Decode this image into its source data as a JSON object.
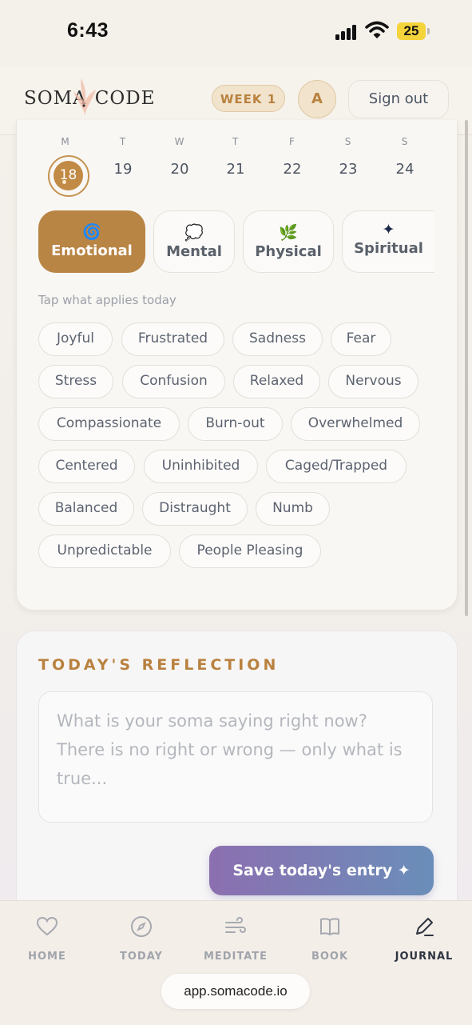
{
  "status_bar": {
    "time": "6:43",
    "battery": "25"
  },
  "header": {
    "logo_left": "SOMA",
    "logo_right": "CODE",
    "week": "WEEK 1",
    "avatar_initial": "A",
    "sign_out": "Sign out"
  },
  "days": [
    {
      "letter": "M",
      "num": "18",
      "selected": true
    },
    {
      "letter": "T",
      "num": "19"
    },
    {
      "letter": "W",
      "num": "20"
    },
    {
      "letter": "T",
      "num": "21"
    },
    {
      "letter": "F",
      "num": "22"
    },
    {
      "letter": "S",
      "num": "23"
    },
    {
      "letter": "S",
      "num": "24"
    }
  ],
  "categories": [
    {
      "label": "Emotional",
      "icon": "spiral-icon",
      "glyph": "🌀",
      "active": true
    },
    {
      "label": "Mental",
      "icon": "thought-bubble-icon",
      "glyph": "💭"
    },
    {
      "label": "Physical",
      "icon": "herb-icon",
      "glyph": "🌿"
    },
    {
      "label": "Spiritual",
      "icon": "sparkle-icon",
      "glyph": "✦"
    }
  ],
  "hint": "Tap what applies today",
  "chips": [
    "Joyful",
    "Frustrated",
    "Sadness",
    "Fear",
    "Stress",
    "Confusion",
    "Relaxed",
    "Nervous",
    "Compassionate",
    "Burn-out",
    "Overwhelmed",
    "Centered",
    "Uninhibited",
    "Caged/Trapped",
    "Balanced",
    "Distraught",
    "Numb",
    "Unpredictable",
    "People Pleasing"
  ],
  "reflection": {
    "title": "TODAY'S REFLECTION",
    "placeholder": "What is your soma saying right now? There is no right or wrong — only what is true...",
    "save_label": "Save today's entry ✦"
  },
  "nav": [
    {
      "label": "HOME",
      "icon": "heart-icon"
    },
    {
      "label": "TODAY",
      "icon": "compass-icon"
    },
    {
      "label": "MEDITATE",
      "icon": "wind-icon"
    },
    {
      "label": "BOOK",
      "icon": "book-icon"
    },
    {
      "label": "JOURNAL",
      "icon": "pen-icon",
      "active": true
    }
  ],
  "browser": {
    "url": "app.somacode.io"
  },
  "colors": {
    "accent": "#b98545",
    "save_start": "#8c6fb0",
    "save_end": "#6a8eb9"
  }
}
